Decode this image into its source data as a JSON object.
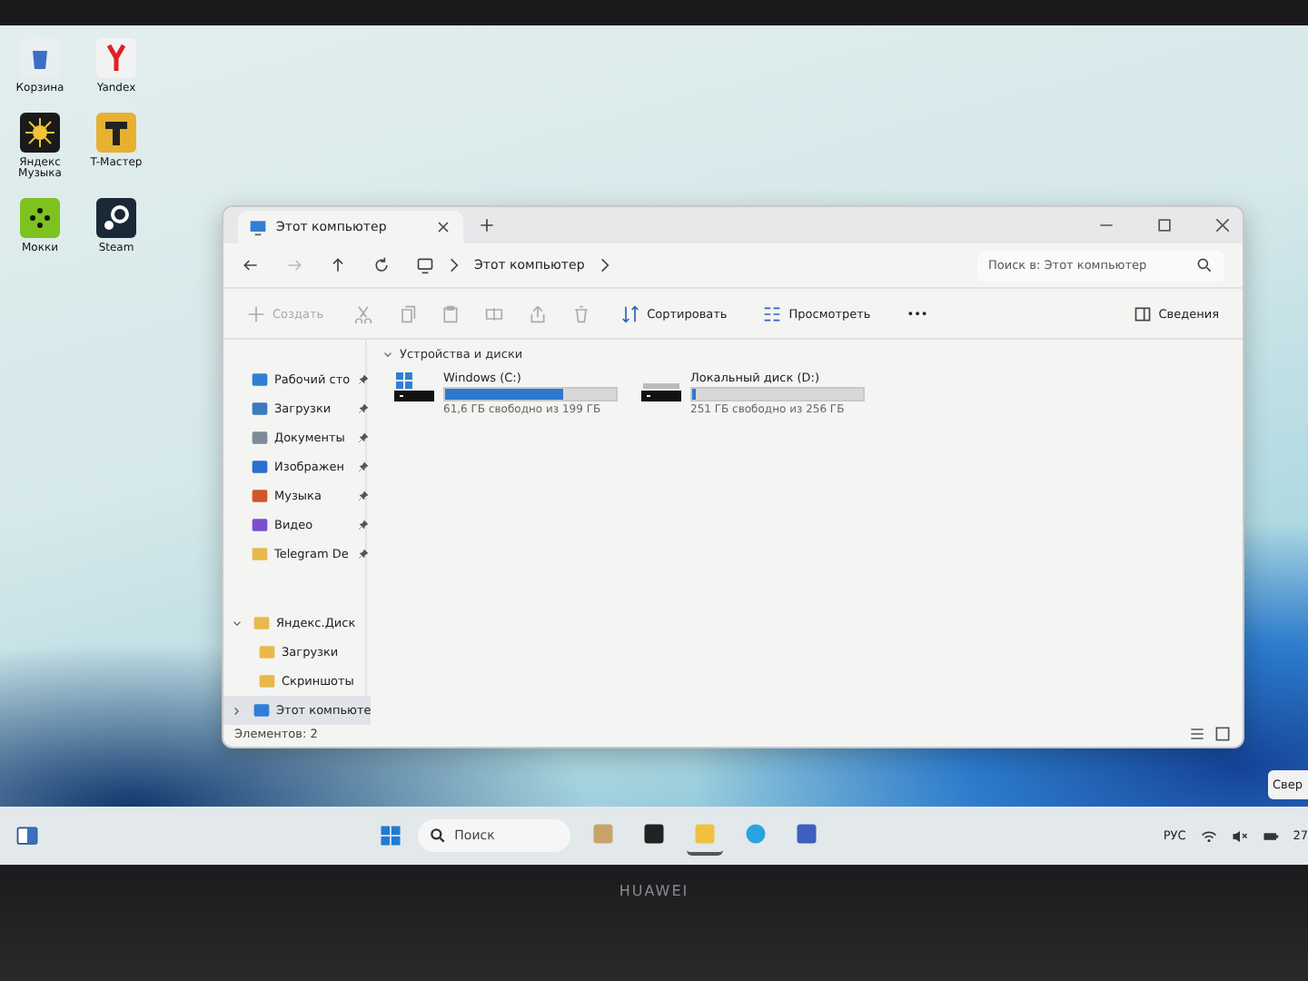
{
  "desktop_icons": [
    {
      "label": "Корзина",
      "kind": "recycle"
    },
    {
      "label": "Yandex",
      "kind": "yandex"
    },
    {
      "label": "Яндекс Музыка",
      "kind": "music"
    },
    {
      "label": "T-Мастер",
      "kind": "tmaster"
    },
    {
      "label": "Мокки",
      "kind": "gamepad"
    },
    {
      "label": "Steam",
      "kind": "steam"
    }
  ],
  "explorer": {
    "tab": {
      "title": "Этот компьютер"
    },
    "address": {
      "path": [
        "Этот компьютер"
      ]
    },
    "search": {
      "placeholder": "Поиск в: Этот компьютер"
    },
    "toolbar": [
      {
        "kind": "new",
        "label": "Создать",
        "disabled": true
      },
      {
        "kind": "cut",
        "disabled": true
      },
      {
        "kind": "copy",
        "disabled": true
      },
      {
        "kind": "paste",
        "disabled": true
      },
      {
        "kind": "rename",
        "disabled": true
      },
      {
        "kind": "share",
        "disabled": true
      },
      {
        "kind": "delete",
        "disabled": true
      },
      {
        "kind": "sort",
        "label": "Сортировать",
        "disabled": false
      },
      {
        "kind": "view",
        "label": "Просмотреть",
        "disabled": false
      },
      {
        "kind": "more",
        "label": "•••",
        "disabled": false
      }
    ],
    "details_button": "Сведения",
    "quick_access": [
      {
        "label": "Рабочий сто",
        "kind": "desktop",
        "pinned": true
      },
      {
        "label": "Загрузки",
        "kind": "download",
        "pinned": true
      },
      {
        "label": "Документы",
        "kind": "docs",
        "pinned": true
      },
      {
        "label": "Изображен",
        "kind": "pictures",
        "pinned": true
      },
      {
        "label": "Музыка",
        "kind": "music",
        "pinned": true
      },
      {
        "label": "Видео",
        "kind": "video",
        "pinned": true
      },
      {
        "label": "Telegram De",
        "kind": "folder",
        "pinned": true
      }
    ],
    "tree": [
      {
        "label": "Яндекс.Диск",
        "kind": "yadisk",
        "expanded": true,
        "selected": false,
        "children": [
          {
            "label": "Загрузки",
            "kind": "folder",
            "selected": false
          },
          {
            "label": "Скриншоты",
            "kind": "folder",
            "selected": false
          }
        ]
      },
      {
        "label": "Этот компьюте",
        "kind": "pc",
        "expanded": false,
        "selected": true
      }
    ],
    "section": {
      "title": "Устройства и диски",
      "expanded": true
    },
    "drives": [
      {
        "name": "Windows (C:)",
        "kind": "system",
        "level": 0.69,
        "free": "61,6 ГБ свободно из 199 ГБ"
      },
      {
        "name": "Локальный диск (D:)",
        "kind": "local",
        "level": 0.02,
        "free": "251 ГБ свободно из 256 ГБ"
      }
    ],
    "status": "Элементов: 2"
  },
  "toast": "Свер",
  "taskbar": {
    "search": {
      "placeholder": "Поиск"
    },
    "apps": [
      {
        "kind": "castle",
        "running": false
      },
      {
        "kind": "terminal",
        "running": false
      },
      {
        "kind": "explorer",
        "running": true
      },
      {
        "kind": "telegram",
        "running": false
      },
      {
        "kind": "window",
        "running": false
      }
    ],
    "language": "РУС",
    "clock": "27"
  },
  "bezel": {
    "brand": "HUAWEI"
  }
}
